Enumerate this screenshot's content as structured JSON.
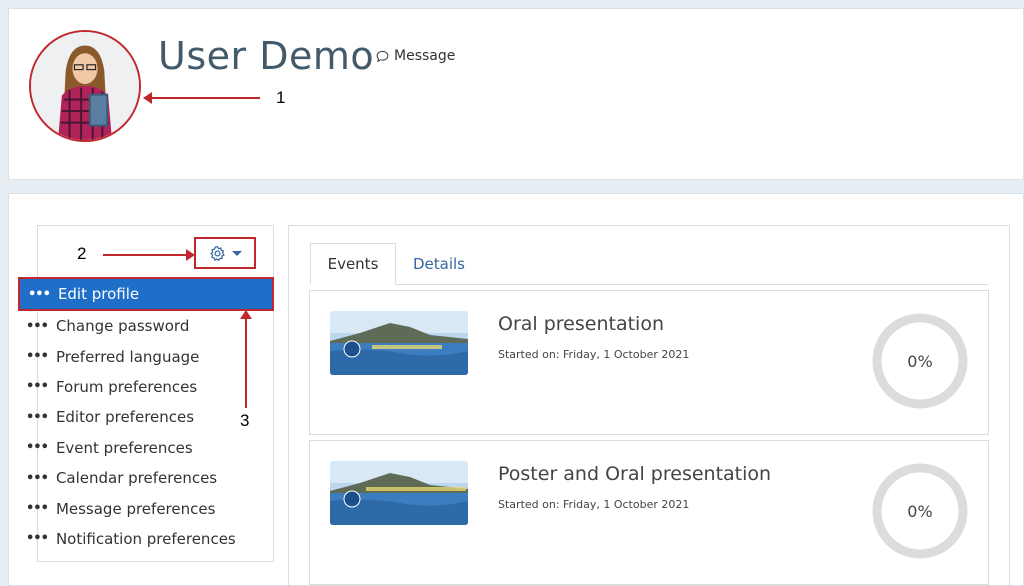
{
  "profile": {
    "name": "User Demo",
    "message_label": "Message"
  },
  "annotations": [
    "1",
    "2",
    "3"
  ],
  "menu": {
    "items": [
      {
        "label": "Edit profile"
      },
      {
        "label": "Change password"
      },
      {
        "label": "Preferred language"
      },
      {
        "label": "Forum preferences"
      },
      {
        "label": "Editor preferences"
      },
      {
        "label": "Event preferences"
      },
      {
        "label": "Calendar preferences"
      },
      {
        "label": "Message preferences"
      },
      {
        "label": "Notification preferences"
      }
    ]
  },
  "tabs": [
    {
      "label": "Events"
    },
    {
      "label": "Details"
    }
  ],
  "events": [
    {
      "title": "Oral presentation",
      "started": "Started on: Friday, 1 October 2021",
      "progress_label": "0%",
      "progress": 0
    },
    {
      "title": "Poster and Oral presentation",
      "started": "Started on: Friday, 1 October 2021",
      "progress_label": "0%",
      "progress": 0
    }
  ],
  "colors": {
    "accent": "#1f6fc8",
    "annotation": "#c0282e",
    "link": "#3566a0"
  },
  "icons": [
    "chat-bubble-icon",
    "gear-icon",
    "caret-down-icon"
  ]
}
